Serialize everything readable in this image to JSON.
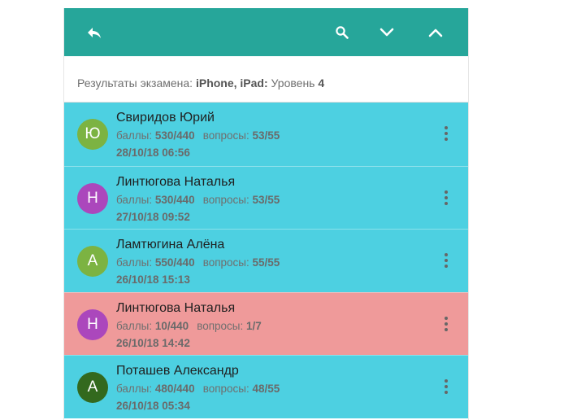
{
  "toolbar": {
    "back_icon": "reply-icon",
    "search_icon": "search-icon",
    "down_icon": "chevron-down-icon",
    "up_icon": "chevron-up-icon",
    "color": "#26a69a"
  },
  "subheader": {
    "prefix": "Результаты экзамена: ",
    "exam": "iPhone, iPad:",
    "level_label": " Уровень ",
    "level": "4"
  },
  "labels": {
    "score": "баллы: ",
    "questions": "вопросы: "
  },
  "results": [
    {
      "initial": "Ю",
      "name": "Свиридов Юрий",
      "score": "530/440",
      "questions": "53/55",
      "date": "28/10/18 06:56",
      "row_color": "#4dd0e1",
      "avatar_color": "#7cb342"
    },
    {
      "initial": "Н",
      "name": "Линтюгова Наталья",
      "score": "530/440",
      "questions": "53/55",
      "date": "27/10/18 09:52",
      "row_color": "#4dd0e1",
      "avatar_color": "#ab47bc"
    },
    {
      "initial": "А",
      "name": "Ламтюгина Алёна",
      "score": "550/440",
      "questions": "55/55",
      "date": "26/10/18 15:13",
      "row_color": "#4dd0e1",
      "avatar_color": "#7cb342"
    },
    {
      "initial": "Н",
      "name": "Линтюгова Наталья",
      "score": "10/440",
      "questions": "1/7",
      "date": "26/10/18 14:42",
      "row_color": "#ef9a9a",
      "avatar_color": "#ab47bc"
    },
    {
      "initial": "А",
      "name": "Поташев Александр",
      "score": "480/440",
      "questions": "48/55",
      "date": "26/10/18 05:34",
      "row_color": "#4dd0e1",
      "avatar_color": "#33691e"
    }
  ]
}
